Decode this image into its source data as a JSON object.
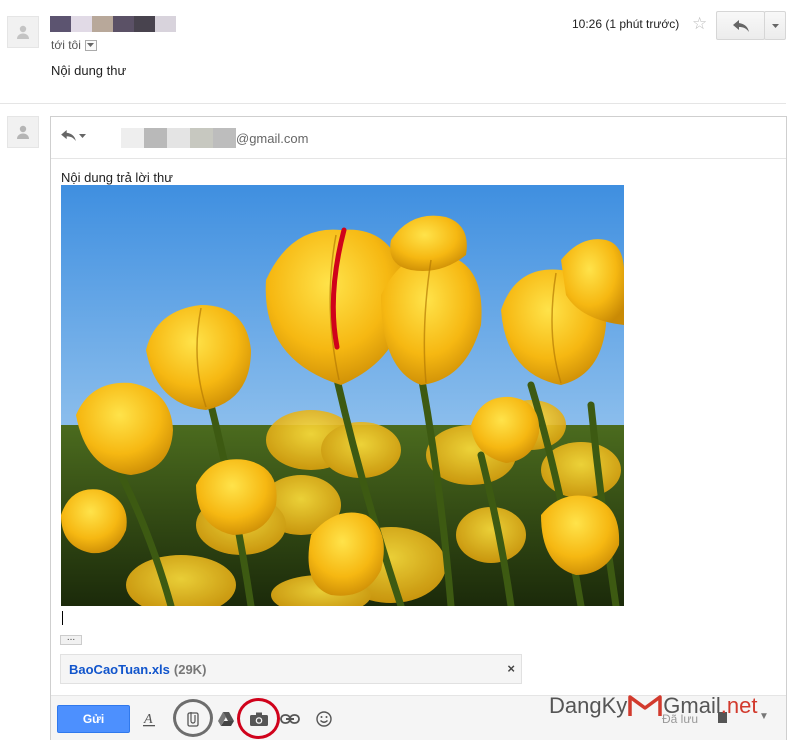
{
  "message": {
    "to_line": "tới tôi",
    "body": "Nội dung thư",
    "time": "10:26 (1 phút trước)",
    "sender_blocks": [
      "#5c5470",
      "#e1dae6",
      "#b8a89a",
      "#5b5166",
      "#48434e",
      "#d8d3dc"
    ]
  },
  "compose": {
    "recipient_suffix": "@gmail.com",
    "recipient_blocks": [
      "#eeeeee",
      "#b9b9b9",
      "#e4e4e4",
      "#c7c8c0",
      "#bdbdbd"
    ],
    "reply_text": "Nội dung trả lời thư",
    "attachment": {
      "name": "BaoCaoTuan.xls",
      "size": "(29K)",
      "close": "×"
    },
    "toolbar": {
      "send_label": "Gửi",
      "saved_label": "Đã lưu"
    }
  },
  "watermark": {
    "part1": "DangKy",
    "part2": "Gmail",
    "part3": ".net"
  },
  "colors": {
    "send_blue": "#4d90fe",
    "link_blue": "#15c",
    "highlight_red": "#d0021b",
    "highlight_gray": "#6d6d6d"
  },
  "icons": [
    "person-icon",
    "star-icon",
    "reply-icon",
    "chevron-down-icon",
    "formatting-icon",
    "attach-icon",
    "drive-icon",
    "photo-icon",
    "link-icon",
    "emoji-icon",
    "trash-icon"
  ]
}
